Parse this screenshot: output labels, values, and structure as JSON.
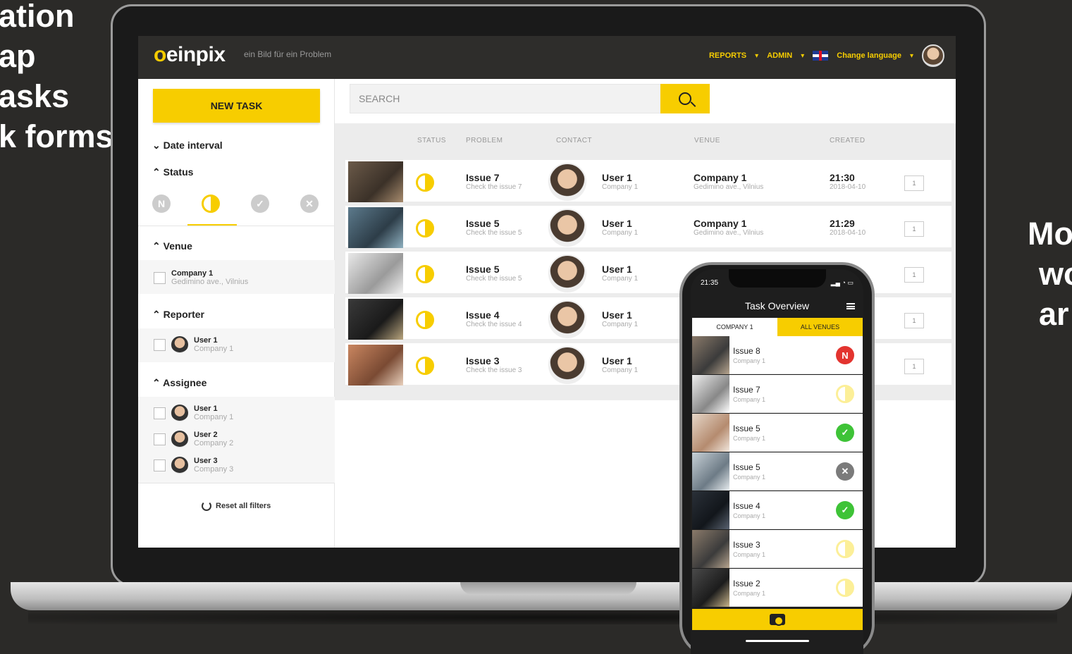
{
  "overlay": {
    "left_lines": [
      "ation",
      "ap",
      "asks",
      "k forms"
    ],
    "right_lines": [
      "Mo",
      "wo",
      "ar"
    ]
  },
  "app": {
    "logo": "einpix",
    "tagline": "ein Bild für ein Problem",
    "nav": [
      "REPORTS",
      "ADMIN",
      "Change language"
    ],
    "accent": "#f7cd00"
  },
  "sidebar": {
    "new_task": "NEW TASK",
    "date_interval": "Date interval",
    "status": "Status",
    "status_icons": [
      "N",
      "half",
      "check",
      "x"
    ],
    "venue_head": "Venue",
    "venue": {
      "name": "Company 1",
      "address": "Gedimino ave., Vilnius"
    },
    "reporter_head": "Reporter",
    "reporter": {
      "name": "User 1",
      "company": "Company 1"
    },
    "assignee_head": "Assignee",
    "assignees": [
      {
        "name": "User 1",
        "company": "Company 1"
      },
      {
        "name": "User 2",
        "company": "Company 2"
      },
      {
        "name": "User 3",
        "company": "Company 3"
      }
    ],
    "reset": "Reset all filters"
  },
  "main": {
    "search_placeholder": "SEARCH",
    "columns": [
      "STATUS",
      "PROBLEM",
      "CONTACT",
      "VENUE",
      "CREATED"
    ],
    "rows": [
      {
        "problem": "Issue 7",
        "problem_sub": "Check the issue 7",
        "contact": "User 1",
        "contact_sub": "Company 1",
        "venue": "Company 1",
        "venue_sub": "Gedimino ave., Vilnius",
        "time": "21:30",
        "date": "2018-04-10",
        "comments": "1"
      },
      {
        "problem": "Issue 5",
        "problem_sub": "Check the issue 5",
        "contact": "User 1",
        "contact_sub": "Company 1",
        "venue": "Company 1",
        "venue_sub": "Gedimino ave., Vilnius",
        "time": "21:29",
        "date": "2018-04-10",
        "comments": "1"
      },
      {
        "problem": "Issue 5",
        "problem_sub": "Check the issue 5",
        "contact": "User 1",
        "contact_sub": "Company 1",
        "venue": "",
        "venue_sub": "",
        "time": "",
        "date": "",
        "comments": "1"
      },
      {
        "problem": "Issue 4",
        "problem_sub": "Check the issue 4",
        "contact": "User 1",
        "contact_sub": "Company 1",
        "venue": "",
        "venue_sub": "",
        "time": "",
        "date": "",
        "comments": "1"
      },
      {
        "problem": "Issue 3",
        "problem_sub": "Check the issue 3",
        "contact": "User 1",
        "contact_sub": "Company 1",
        "venue": "",
        "venue_sub": "",
        "time": "",
        "date": "",
        "comments": "1"
      }
    ]
  },
  "phone": {
    "time": "21:35",
    "title": "Task Overview",
    "tab_company": "COMPANY 1",
    "tab_venues": "ALL VENUES",
    "rows": [
      {
        "title": "Issue 8",
        "sub": "Company 1",
        "status": "N"
      },
      {
        "title": "Issue 7",
        "sub": "Company 1",
        "status": "half"
      },
      {
        "title": "Issue 5",
        "sub": "Company 1",
        "status": "check"
      },
      {
        "title": "Issue 5",
        "sub": "Company 1",
        "status": "x"
      },
      {
        "title": "Issue 4",
        "sub": "Company 1",
        "status": "check"
      },
      {
        "title": "Issue 3",
        "sub": "Company 1",
        "status": "half"
      },
      {
        "title": "Issue 2",
        "sub": "Company 1",
        "status": "half"
      }
    ]
  }
}
